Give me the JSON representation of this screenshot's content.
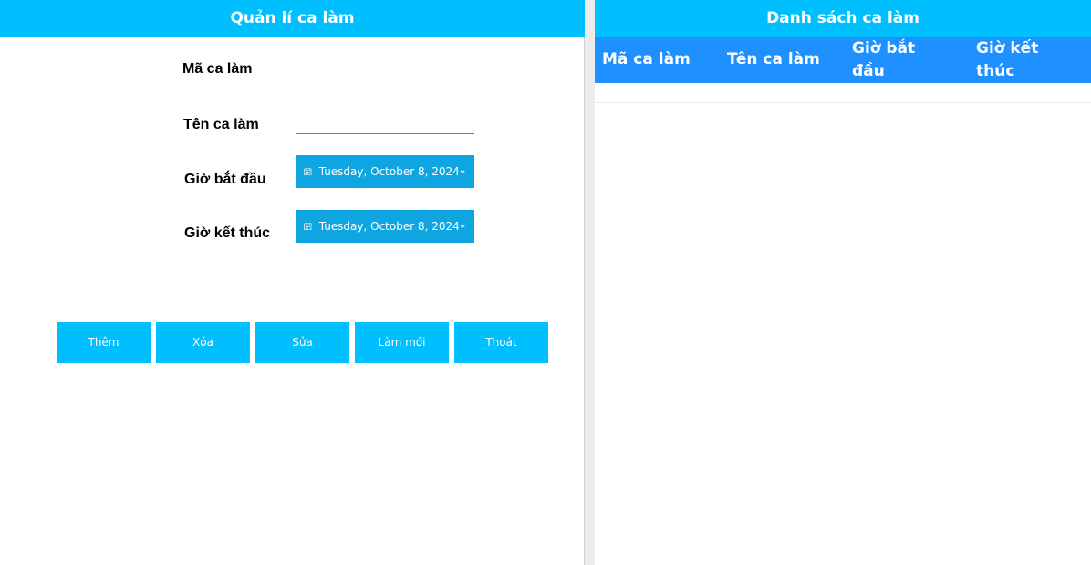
{
  "left": {
    "title": "Quản lí ca làm",
    "fields": {
      "ma_ca_lam": {
        "label": "Mã ca làm",
        "value": ""
      },
      "ten_ca_lam": {
        "label": "Tên ca làm",
        "value": ""
      },
      "gio_bat_dau": {
        "label": "Giờ bắt đầu",
        "value": "Tuesday, October 8, 2024"
      },
      "gio_ket_thuc": {
        "label": "Giờ kết thúc",
        "value": "Tuesday, October 8, 2024"
      }
    },
    "buttons": {
      "them": "Thêm",
      "xoa": "Xóa",
      "sua": "Sửa",
      "lam_moi": "Làm mới",
      "thoat": "Thoát"
    }
  },
  "right": {
    "title": "Danh sách ca làm",
    "columns": [
      "Mã ca làm",
      "Tên ca làm",
      "Giờ bắt đầu",
      "Giờ kết thúc"
    ],
    "rows": []
  },
  "icons": {
    "date_picker": "calendar-icon",
    "dropdown": "chevron-down-icon"
  },
  "colors": {
    "header": "#00bfff",
    "grid_header": "#1e90ff",
    "date_picker": "#0ea5e0",
    "button": "#00bfff"
  }
}
